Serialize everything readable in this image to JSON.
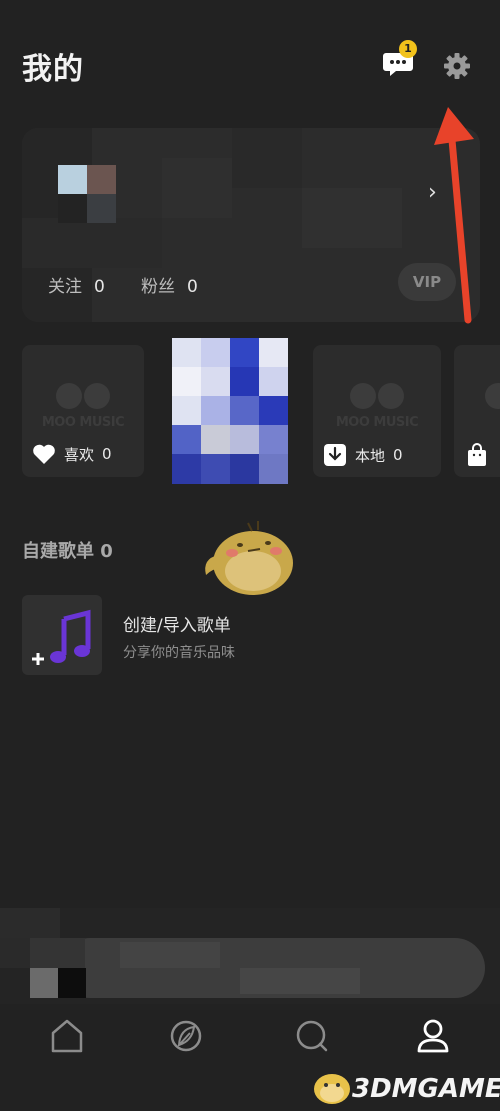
{
  "header": {
    "title": "我的",
    "message_badge": "1"
  },
  "profile": {
    "follow_label": "关注",
    "follow_count": "0",
    "fans_label": "粉丝",
    "fans_count": "0",
    "vip_label": "VIP",
    "chevron": "›"
  },
  "tiles": [
    {
      "watermark": "MOO MUSIC",
      "label": "喜欢",
      "count": "0",
      "icon": "heart-icon"
    },
    {
      "watermark": "MOO MUSIC",
      "label": "本地",
      "count": "0",
      "icon": "download-icon"
    },
    {
      "icon": "bag-icon"
    }
  ],
  "playlists": {
    "title": "自建歌单",
    "count": "0",
    "create": {
      "title": "创建/导入歌单",
      "subtitle": "分享你的音乐品味",
      "icon": "music-note-icon"
    }
  },
  "nav": [
    {
      "name": "home",
      "icon": "home-icon"
    },
    {
      "name": "discover",
      "icon": "leaf-icon"
    },
    {
      "name": "search",
      "icon": "search-icon"
    },
    {
      "name": "mine",
      "icon": "user-icon"
    }
  ],
  "watermark": {
    "text": "3DMGAME"
  },
  "colors": {
    "background": "#222222",
    "card": "#2c2c2c",
    "badge": "#f2c21b",
    "arrow": "#e8432a",
    "note": "#6a35d6"
  }
}
